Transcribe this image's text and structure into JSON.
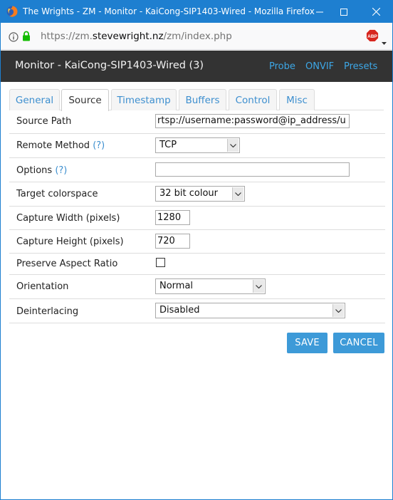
{
  "window": {
    "title": "The Wrights - ZM - Monitor - KaiCong-SIP1403-Wired - Mozilla Firefox",
    "icons": {
      "app": "firefox-icon",
      "minimize": "minimize-icon",
      "maximize": "maximize-icon",
      "close": "close-icon"
    }
  },
  "urlbar": {
    "url_prefix": "https://zm.",
    "url_domain": "stevewright.nz",
    "url_path": "/zm/index.php",
    "icons": {
      "info": "info-icon",
      "lock": "lock-icon",
      "adblock": "adblock-plus-icon",
      "menu": "chevron-down-icon"
    },
    "adblock_label": "ABP"
  },
  "header": {
    "title": "Monitor - KaiCong-SIP1403-Wired (3)",
    "links": [
      "Probe",
      "ONVIF",
      "Presets"
    ]
  },
  "tabs": [
    {
      "label": "General"
    },
    {
      "label": "Source",
      "active": true
    },
    {
      "label": "Timestamp"
    },
    {
      "label": "Buffers"
    },
    {
      "label": "Control"
    },
    {
      "label": "Misc"
    }
  ],
  "form": {
    "source_path": {
      "label": "Source Path",
      "value": "rtsp://username:password@ip_address/u"
    },
    "remote_method": {
      "label": "Remote Method",
      "help": "(?)",
      "value": "TCP"
    },
    "options": {
      "label": "Options",
      "help": "(?)",
      "value": ""
    },
    "target_colorspace": {
      "label": "Target colorspace",
      "value": "32 bit colour"
    },
    "capture_width": {
      "label": "Capture Width (pixels)",
      "value": "1280"
    },
    "capture_height": {
      "label": "Capture Height (pixels)",
      "value": "720"
    },
    "preserve_aspect": {
      "label": "Preserve Aspect Ratio",
      "checked": false
    },
    "orientation": {
      "label": "Orientation",
      "value": "Normal"
    },
    "deinterlacing": {
      "label": "Deinterlacing",
      "value": "Disabled"
    }
  },
  "buttons": {
    "save": "SAVE",
    "cancel": "CANCEL"
  },
  "colors": {
    "titlebar": "#1e7fd0",
    "header": "#333333",
    "link": "#3da7e6",
    "button": "#3d9ad8"
  }
}
